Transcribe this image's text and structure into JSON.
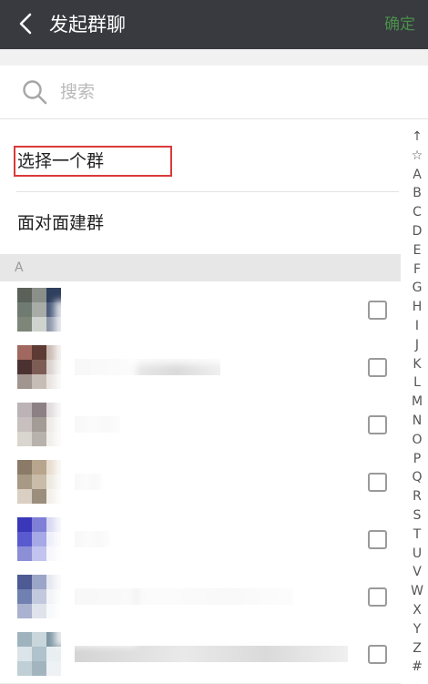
{
  "header": {
    "title": "发起群聊",
    "confirm_label": "确定"
  },
  "search": {
    "placeholder": "搜索"
  },
  "options": [
    {
      "label": "选择一个群"
    },
    {
      "label": "面对面建群"
    }
  ],
  "section": {
    "letter": "A"
  },
  "contacts": [
    {
      "avatar_colors": [
        "#5a6158",
        "#8a8f89",
        "#2f3f5e",
        "#6f7a70",
        "#a7aca6",
        "#4b5b7c",
        "#7d8678",
        "#cfd3cd",
        "#8a94a8"
      ]
    },
    {
      "avatar_colors": [
        "#a0685e",
        "#5d3a33",
        "#c9b9b2",
        "#4b3230",
        "#7d5c55",
        "#d8d0cd",
        "#a1958f",
        "#c7bdb7",
        "#e9e4e1"
      ]
    },
    {
      "avatar_colors": [
        "#bcb3b7",
        "#8c8085",
        "#e0dadc",
        "#c7c0be",
        "#a39b95",
        "#ecebe6",
        "#d9d5cf",
        "#b7b2ac",
        "#f1efeb"
      ]
    },
    {
      "avatar_colors": [
        "#8b7a68",
        "#b8a58d",
        "#e7dccf",
        "#a79984",
        "#c9bca8",
        "#ede8df",
        "#d9cfc2",
        "#9c8e7d",
        "#f3f0ea"
      ]
    },
    {
      "avatar_colors": [
        "#3a38b8",
        "#7f7fd8",
        "#d7d8f2",
        "#5a5ad0",
        "#a7a8e6",
        "#eeeefa",
        "#8c8fd6",
        "#c2c4ef",
        "#f6f6fd"
      ]
    },
    {
      "avatar_colors": [
        "#4d5a94",
        "#9aa5c8",
        "#e6e8f0",
        "#7080b0",
        "#c2c9de",
        "#f2f3f7",
        "#aab2cf",
        "#dfe3ec",
        "#f8f9fb"
      ]
    },
    {
      "avatar_colors": [
        "#9fb3bf",
        "#c9d6dc",
        "#7f96a3",
        "#dbe4e8",
        "#b0c2cb",
        "#e9eef1",
        "#c0cfd6",
        "#a2b5bf",
        "#eef2f4"
      ]
    }
  ],
  "index_letters": [
    "↑",
    "☆",
    "A",
    "B",
    "C",
    "D",
    "E",
    "F",
    "G",
    "H",
    "I",
    "J",
    "K",
    "L",
    "M",
    "N",
    "O",
    "P",
    "Q",
    "R",
    "S",
    "T",
    "U",
    "V",
    "W",
    "X",
    "Y",
    "Z",
    "#"
  ]
}
